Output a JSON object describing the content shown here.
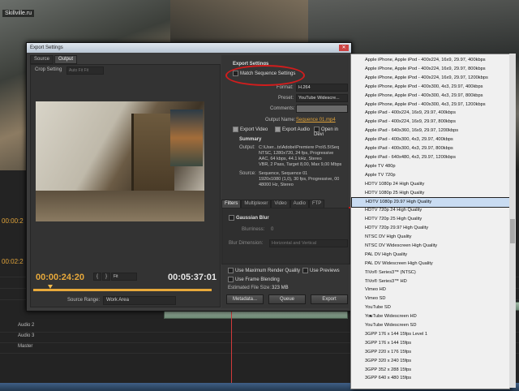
{
  "watermark": "Skillville.ru",
  "dialog": {
    "title": "Export Settings",
    "tabs": [
      "Source",
      "Output"
    ],
    "crop_label": "Crop Setting",
    "crop_value": "Auto Fit Fit",
    "timecode_in": "00:00:24:20",
    "timecode_out": "00:05:37:01",
    "fit_value": "Fit",
    "source_range_label": "Source Range:",
    "source_range_value": "Work Area"
  },
  "export": {
    "section_title": "Export Settings",
    "match_sequence_label": "Match Sequence Settings",
    "format_label": "Format:",
    "format_value": "H.264",
    "preset_label": "Preset:",
    "preset_value": "YouTube Widescre...",
    "comments_label": "Comments:",
    "output_name_label": "Output Name:",
    "output_name_value": "Sequence 01.mp4",
    "export_video_label": "Export Video",
    "export_audio_label": "Export Audio",
    "open_in_device_label": "Open in Devi",
    "summary_title": "Summary",
    "output_label": "Output:",
    "output_lines": [
      "C:\\User...ts\\Adobe\\Premiere Pro\\5.5\\Seq",
      "NTSC, 1280x720, 24 fps, Progressive",
      "AAC, 64 kbps, 44.1 kHz, Stereo",
      "VBR, 2 Pass, Target 8,00, Max 9,00 Mbps"
    ],
    "source_label": "Source:",
    "source_lines": [
      "Sequence, Sequence 01",
      "1920x1080 (1,0), 30 fps, Progressive, 00",
      "48000 Hz, Stereo"
    ]
  },
  "filters": {
    "tabs": [
      "Filters",
      "Multiplexer",
      "Video",
      "Audio",
      "FTP"
    ],
    "gaussian_blur_label": "Gaussian Blur",
    "blurriness_label": "Blurriness:",
    "blurriness_value": "0",
    "blur_dimension_label": "Blur Dimension:",
    "blur_dimension_value": "Horizontal and Vertical",
    "use_max_render_label": "Use Maximum Render Quality",
    "use_previews_label": "Use Previews",
    "use_frame_blending_label": "Use Frame Blending",
    "file_size_label": "Estimated File Size:",
    "file_size_value": "323 MB",
    "metadata_button": "Metadata...",
    "queue_button": "Queue",
    "export_button": "Export"
  },
  "timeline": {
    "tc1": "00:00:2",
    "tc2": "00:02:2",
    "tracks": [
      "Audio 2",
      "Audio 3",
      "Master"
    ]
  },
  "preset_menu": {
    "items": [
      "Apple iPhone, Apple iPod - 400x224, 16x9, 29.97, 400kbps",
      "Apple iPhone, Apple iPod - 400x224, 16x9, 29.97, 800kbps",
      "Apple iPhone, Apple iPod - 400x224, 16x9, 29.97, 1200kbps",
      "Apple iPhone, Apple iPod - 400x300, 4x3, 29.97, 400kbps",
      "Apple iPhone, Apple iPod - 400x300, 4x3, 29.97, 800kbps",
      "Apple iPhone, Apple iPod - 400x300, 4x3, 29.97, 1200kbps",
      "Apple iPad - 400x224, 16x9, 29.97, 400kbps",
      "Apple iPad - 400x224, 16x9, 29.97, 800kbps",
      "Apple iPad - 640x360, 16x9, 29.97, 1200kbps",
      "Apple iPad - 400x300, 4x3, 29.97, 400kbps",
      "Apple iPad - 400x300, 4x3, 29.97, 800kbps",
      "Apple iPad - 640x480, 4x3, 29.97, 1200kbps",
      "Apple TV 480p",
      "Apple TV 720p",
      "HDTV 1080p 24 High Quality",
      "HDTV 1080p 25 High Quality",
      "HDTV 1080p 29.97 High Quality",
      "HDTV 720p 24 High Quality",
      "HDTV 720p 25 High Quality",
      "HDTV 720p 29.97 High Quality",
      "NTSC DV High Quality",
      "NTSC DV Widescreen High Quality",
      "PAL DV High Quality",
      "PAL DV Widescreen High Quality",
      "TiVo® Series3™ (NTSC)",
      "TiVo® Series3™ HD",
      "Vimeo HD",
      "Vimeo SD",
      "YouTube SD",
      "YouTube Widescreen HD",
      "YouTube Widescreen SD",
      "3GPP 176 x 144 15fps Level 1",
      "3GPP 176 x 144 15fps",
      "3GPP 220 x 176 15fps",
      "3GPP 320 x 240 15fps",
      "3GPP 352 x 288 15fps",
      "3GPP 640 x 480 15fps"
    ],
    "checked_index": 29,
    "highlighted_index": 16
  },
  "colors": {
    "accent": "#e0a33a",
    "annotation": "#d11d1d",
    "menu_highlight": "#c9dcf2"
  }
}
